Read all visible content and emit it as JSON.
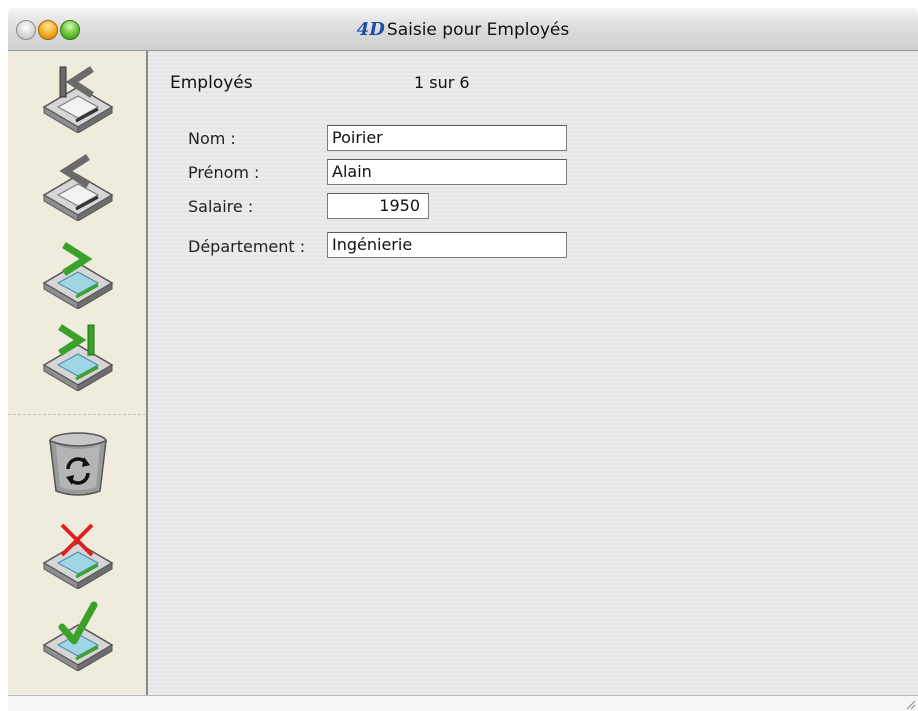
{
  "window": {
    "title": "Saisie pour  Employés",
    "logo": "4D",
    "controls": [
      "close",
      "minimize",
      "zoom"
    ]
  },
  "sidebar": {
    "buttons": [
      {
        "name": "first-record",
        "icon": "first-record-icon"
      },
      {
        "name": "previous-record",
        "icon": "previous-record-icon"
      },
      {
        "name": "next-record",
        "icon": "next-record-icon"
      },
      {
        "name": "last-record",
        "icon": "last-record-icon"
      },
      {
        "name": "delete-record",
        "icon": "trash-icon"
      },
      {
        "name": "cancel",
        "icon": "cancel-icon"
      },
      {
        "name": "accept",
        "icon": "accept-icon"
      }
    ]
  },
  "form": {
    "table_name": "Employés",
    "record_position": "1 sur 6",
    "fields": [
      {
        "label": "Nom :",
        "value": "Poirier"
      },
      {
        "label": "Prénom :",
        "value": "Alain"
      },
      {
        "label": "Salaire :",
        "value": "1950"
      },
      {
        "label": "Département :",
        "value": "Ingénierie"
      }
    ]
  },
  "colors": {
    "sidebar_bg": "#efecdd",
    "logo": "#1d4fa8",
    "arrow_green": "#3aa12a",
    "cancel_red": "#e02020"
  }
}
